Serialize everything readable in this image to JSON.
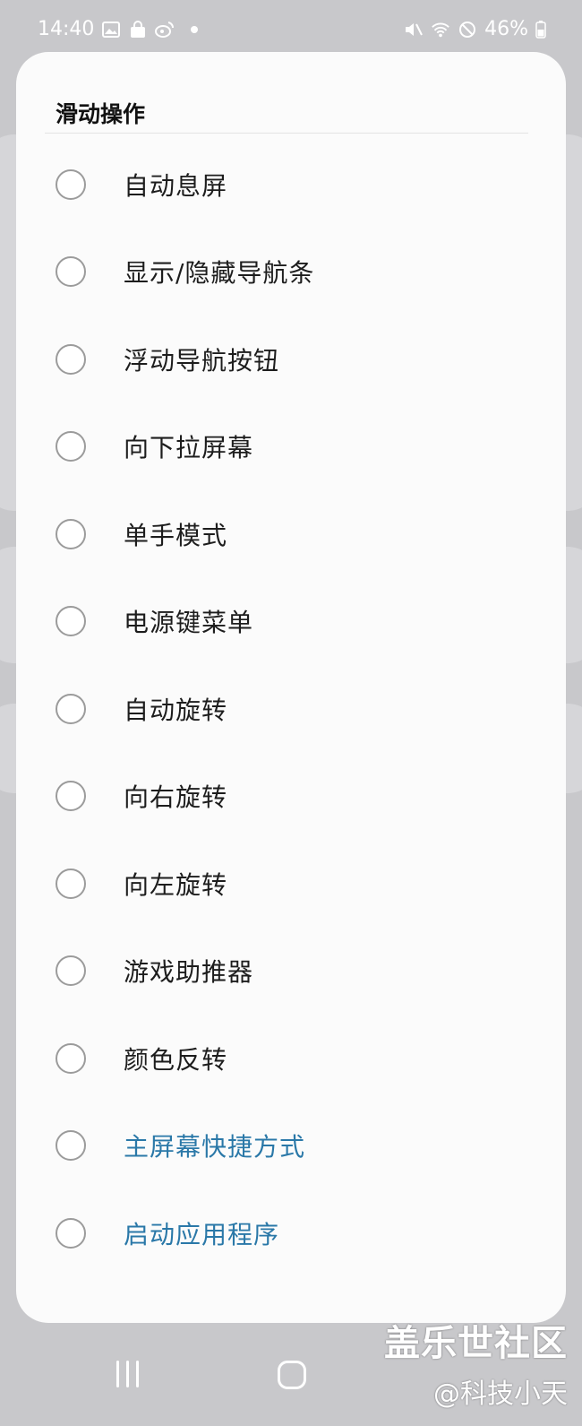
{
  "status_bar": {
    "time": "14:40",
    "battery": "46%",
    "left_icons": [
      "image-icon",
      "shopping-bag-icon",
      "weibo-icon"
    ],
    "right_icons": [
      "mute-icon",
      "wifi-icon",
      "block-icon",
      "battery-icon"
    ]
  },
  "dialog": {
    "title": "滑动操作",
    "options": [
      {
        "label": "自动息屏",
        "color": "#1d1d1d"
      },
      {
        "label": "显示/隐藏导航条",
        "color": "#1d1d1d"
      },
      {
        "label": "浮动导航按钮",
        "color": "#1d1d1d"
      },
      {
        "label": "向下拉屏幕",
        "color": "#1d1d1d"
      },
      {
        "label": "单手模式",
        "color": "#1d1d1d"
      },
      {
        "label": "电源键菜单",
        "color": "#1d1d1d"
      },
      {
        "label": "自动旋转",
        "color": "#1d1d1d"
      },
      {
        "label": "向右旋转",
        "color": "#1d1d1d"
      },
      {
        "label": "向左旋转",
        "color": "#1d1d1d"
      },
      {
        "label": "游戏助推器",
        "color": "#1d1d1d"
      },
      {
        "label": "颜色反转",
        "color": "#1d1d1d"
      },
      {
        "label": "主屏幕快捷方式",
        "color": "#2a78a8"
      },
      {
        "label": "启动应用程序",
        "color": "#2a78a8"
      }
    ]
  },
  "watermark": {
    "line1": "盖乐世社区",
    "line2": "@科技小天"
  },
  "nav_icons": [
    "recent-apps-icon",
    "home-icon"
  ]
}
